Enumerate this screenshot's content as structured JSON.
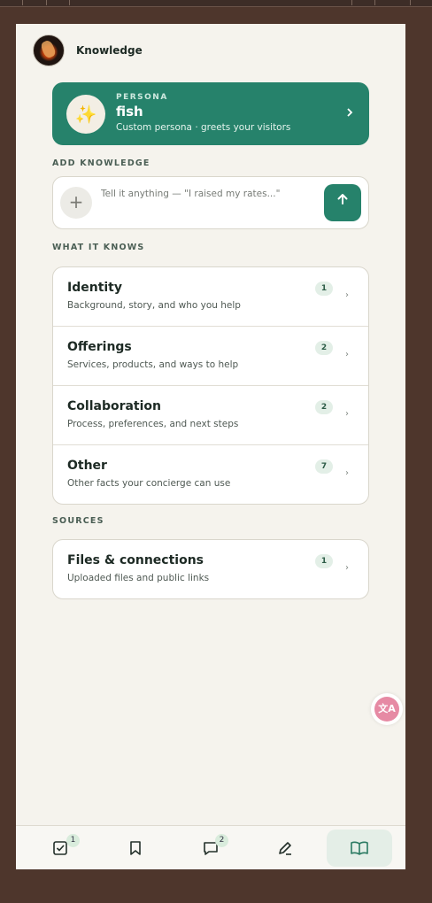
{
  "header": {
    "title": "Knowledge"
  },
  "persona": {
    "kicker": "PERSONA",
    "name": "fish",
    "subtitle": "Custom persona · greets your visitors",
    "icon": "sparkles-icon"
  },
  "add_knowledge": {
    "label": "ADD KNOWLEDGE",
    "placeholder": "Tell it anything — \"I raised my rates...\"",
    "add_icon": "plus-icon",
    "send_icon": "arrow-up-icon"
  },
  "what_it_knows": {
    "label": "WHAT IT KNOWS",
    "items": [
      {
        "title": "Identity",
        "subtitle": "Background, story, and who you help",
        "count": "1"
      },
      {
        "title": "Offerings",
        "subtitle": "Services, products, and ways to help",
        "count": "2"
      },
      {
        "title": "Collaboration",
        "subtitle": "Process, preferences, and next steps",
        "count": "2"
      },
      {
        "title": "Other",
        "subtitle": "Other facts your concierge can use",
        "count": "7"
      }
    ]
  },
  "sources": {
    "label": "SOURCES",
    "items": [
      {
        "title": "Files & connections",
        "subtitle": "Uploaded files and public links",
        "count": "1"
      }
    ]
  },
  "bottom_nav": {
    "items": [
      {
        "icon": "checkbox-icon",
        "badge": "1"
      },
      {
        "icon": "bookmark-icon",
        "badge": ""
      },
      {
        "icon": "chat-icon",
        "badge": "2"
      },
      {
        "icon": "pen-icon",
        "badge": ""
      },
      {
        "icon": "book-icon",
        "badge": ""
      }
    ]
  },
  "colors": {
    "accent": "#26826b",
    "background": "#f5f3ed",
    "frame": "#4e362c"
  }
}
